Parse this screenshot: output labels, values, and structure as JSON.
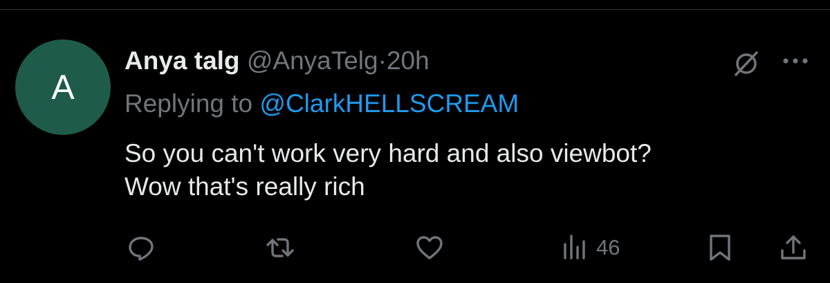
{
  "tweet": {
    "avatar_letter": "A",
    "display_name": "Anya talg",
    "handle": "@AnyaTelg",
    "separator": "·",
    "time": "20h",
    "replying_prefix": "Replying to",
    "replying_to": "@ClarkHELLSCREAM",
    "text_lines": [
      "So you can't work very hard and also viewbot?",
      "Wow that's really rich"
    ],
    "views": "46"
  },
  "icons": {
    "top_right": [
      "grok-icon",
      "more-icon"
    ],
    "actions": [
      "reply-icon",
      "retweet-icon",
      "like-icon",
      "views-icon",
      "bookmark-icon",
      "share-icon"
    ]
  },
  "colors": {
    "background": "#000000",
    "text_primary": "#e7e9ea",
    "text_secondary": "#71767b",
    "accent": "#1d9bf0",
    "avatar": "#1e5b4b"
  }
}
